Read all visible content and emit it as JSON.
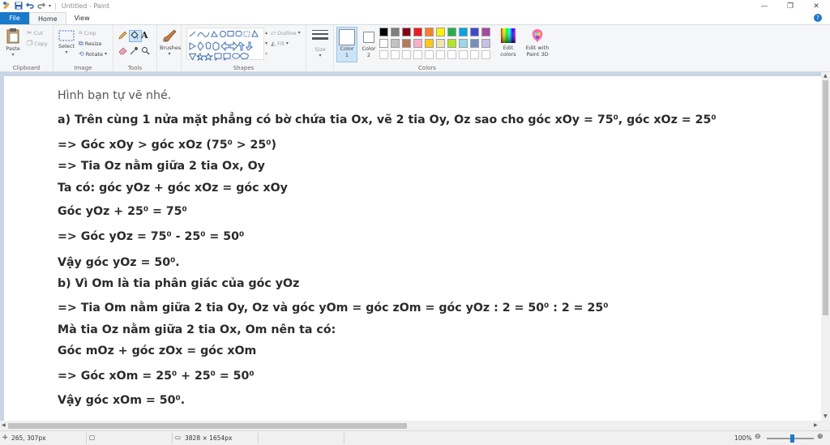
{
  "window": {
    "title": "Untitled - Paint"
  },
  "tabs": {
    "file": "File",
    "home": "Home",
    "view": "View"
  },
  "clipboard": {
    "paste": "Paste",
    "cut": "Cut",
    "copy": "Copy",
    "group": "Clipboard"
  },
  "image": {
    "select": "Select",
    "crop": "Crop",
    "resize": "Resize",
    "rotate": "Rotate",
    "group": "Image"
  },
  "tools": {
    "group": "Tools",
    "brushes": "Brushes"
  },
  "shapes": {
    "outline": "Outline",
    "fill": "Fill",
    "group": "Shapes",
    "size": "Size"
  },
  "colors": {
    "color1": "Color",
    "color1_num": "1",
    "color2": "Color",
    "color2_num": "2",
    "edit_colors_l1": "Edit",
    "edit_colors_l2": "colors",
    "paint3d_l1": "Edit with",
    "paint3d_l2": "Paint 3D",
    "group": "Colors",
    "palette_row1": [
      "#000000",
      "#7f7f7f",
      "#880015",
      "#ed1c24",
      "#ff7f27",
      "#fff200",
      "#22b14c",
      "#00a2e8",
      "#3f48cc",
      "#a349a4"
    ],
    "palette_row2": [
      "#ffffff",
      "#c3c3c3",
      "#b97a57",
      "#ffaec9",
      "#ffc90e",
      "#efe4b0",
      "#b5e61d",
      "#99d9ea",
      "#7092be",
      "#c8bfe7"
    ]
  },
  "canvas_text": [
    "Hình bạn tự vẽ nhé.",
    "a) Trên cùng 1 nửa mặt phẳng có bờ chứa tia Ox, vẽ 2 tia Oy, Oz sao cho góc xOy = 75⁰, góc xOz = 25⁰",
    "=> Góc xOy > góc xOz (75⁰ > 25⁰)",
    "=> Tia Oz nằm giữa 2 tia Ox, Oy",
    "Ta có: góc yOz + góc xOz = góc xOy",
    "Góc yOz + 25⁰ = 75⁰",
    "=> Góc yOz = 75⁰ - 25⁰ = 50⁰",
    "Vậy góc yOz = 50⁰.",
    "b) Vì Om là tia phân giác của góc yOz",
    "=> Tia Om nằm giữa 2 tia Oy, Oz và góc yOm = góc zOm = góc yOz : 2 = 50⁰ : 2 = 25⁰",
    "Mà tia Oz nằm giữa 2 tia Ox, Om nên ta có:",
    "Góc mOz + góc zOx = góc xOm",
    "=> Góc xOm = 25⁰ + 25⁰ = 50⁰",
    "Vậy góc xOm = 50⁰."
  ],
  "status": {
    "cursor_pos": "265, 307px",
    "image_size": "3828 × 1654px",
    "zoom": "100%",
    "zoom_fraction": 0.55
  }
}
